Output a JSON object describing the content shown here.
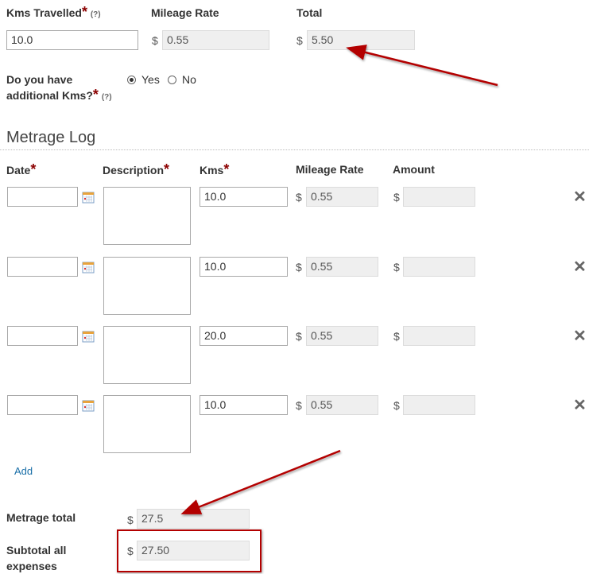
{
  "mileage": {
    "kms_label": "Kms Travelled",
    "kms_help": "(?)",
    "kms_value": "10.0",
    "rate_label": "Mileage Rate",
    "rate_currency": "$",
    "rate_value": "0.55",
    "total_label": "Total",
    "total_currency": "$",
    "total_value": "5.50"
  },
  "additional": {
    "question_line1": "Do you have",
    "question_line2": "additional Kms?",
    "help": "(?)",
    "option_yes": "Yes",
    "option_no": "No",
    "selected": "Yes"
  },
  "metrage_log": {
    "title": "Metrage Log",
    "columns": {
      "date": "Date",
      "description": "Description",
      "kms": "Kms",
      "mileage_rate": "Mileage Rate",
      "amount": "Amount"
    },
    "rows": [
      {
        "date": "",
        "description": "",
        "kms": "10.0",
        "rate_currency": "$",
        "rate": "0.55",
        "amount_currency": "$",
        "amount": ""
      },
      {
        "date": "",
        "description": "",
        "kms": "10.0",
        "rate_currency": "$",
        "rate": "0.55",
        "amount_currency": "$",
        "amount": ""
      },
      {
        "date": "",
        "description": "",
        "kms": "20.0",
        "rate_currency": "$",
        "rate": "0.55",
        "amount_currency": "$",
        "amount": ""
      },
      {
        "date": "",
        "description": "",
        "kms": "10.0",
        "rate_currency": "$",
        "rate": "0.55",
        "amount_currency": "$",
        "amount": ""
      }
    ],
    "remove_glyph": "✕",
    "add_label": "Add"
  },
  "totals": {
    "metrage_total_label": "Metrage total",
    "metrage_total_currency": "$",
    "metrage_total_value": "27.5",
    "subtotal_line1": "Subtotal all",
    "subtotal_line2": "expenses",
    "subtotal_currency": "$",
    "subtotal_value": "27.50"
  },
  "annotations": {
    "arrow_color": "#b30000",
    "box_color": "#b30000"
  }
}
